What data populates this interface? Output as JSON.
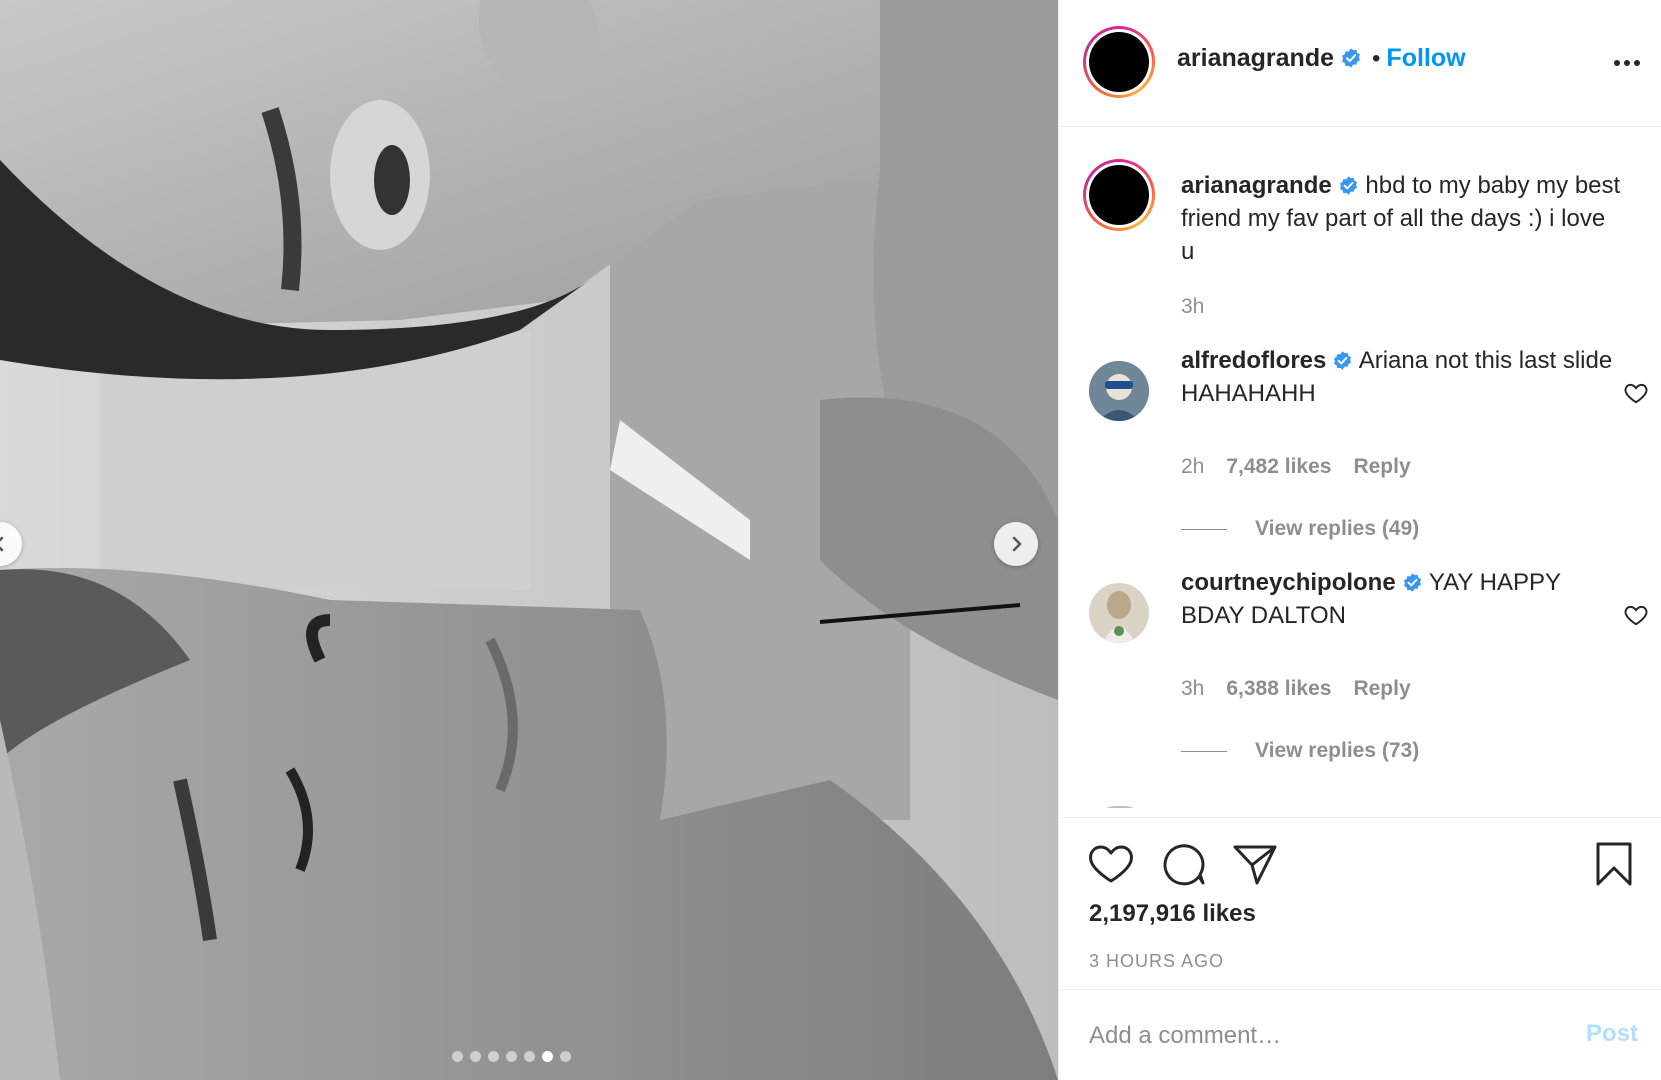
{
  "post": {
    "photo_alt": "",
    "carousel": {
      "total": 7,
      "active_index": 5
    }
  },
  "header": {
    "username": "arianagrande",
    "follow_separator": "•",
    "follow_label": "Follow"
  },
  "caption": {
    "username": "arianagrande",
    "text": "hbd to my baby my best friend my fav part of all the days :) i love u",
    "time": "3h"
  },
  "comments": [
    {
      "username": "alfredoflores",
      "text": "Ariana not this last slide HAHAHAHH",
      "time": "2h",
      "likes": "7,482 likes",
      "reply_label": "Reply",
      "view_replies": "View replies (49)"
    },
    {
      "username": "courtneychipolone",
      "text": "YAY HAPPY BDAY DALTON",
      "time": "3h",
      "likes": "6,388 likes",
      "reply_label": "Reply",
      "view_replies": "View replies (73)"
    }
  ],
  "actions": {
    "likes": "2,197,916 likes",
    "time_ago": "3 HOURS AGO"
  },
  "add_comment": {
    "placeholder": "Add a comment…",
    "post_label": "Post"
  },
  "colors": {
    "link_blue": "#0095f6",
    "verified_blue": "#3897f0",
    "muted_text": "#8e8e8e",
    "post_disabled": "#b2dffc"
  },
  "icons": [
    "verified-badge-icon",
    "more-options-icon",
    "heart-icon",
    "comment-icon",
    "share-icon",
    "bookmark-icon",
    "chevron-left-icon",
    "chevron-right-icon"
  ]
}
